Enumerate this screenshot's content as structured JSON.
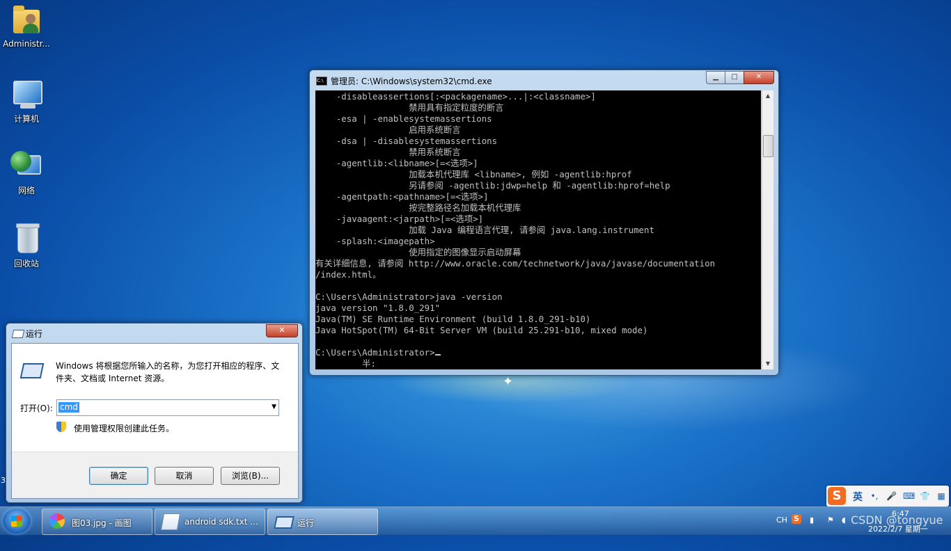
{
  "desktop": {
    "icons": [
      {
        "label": "Administr..."
      },
      {
        "label": "计算机"
      },
      {
        "label": "网络"
      },
      {
        "label": "回收站"
      }
    ]
  },
  "cmd_window": {
    "title": "管理员: C:\\Windows\\system32\\cmd.exe",
    "controls": {
      "minimize": "▁",
      "maximize": "□",
      "close": "✕"
    },
    "lines": [
      "    -disableassertions[:<packagename>...|:<classname>]",
      "                  禁用具有指定粒度的断言",
      "    -esa | -enablesystemassertions",
      "                  启用系统断言",
      "    -dsa | -disablesystemassertions",
      "                  禁用系统断言",
      "    -agentlib:<libname>[=<选项>]",
      "                  加载本机代理库 <libname>, 例如 -agentlib:hprof",
      "                  另请参阅 -agentlib:jdwp=help 和 -agentlib:hprof=help",
      "    -agentpath:<pathname>[=<选项>]",
      "                  按完整路径名加载本机代理库",
      "    -javaagent:<jarpath>[=<选项>]",
      "                  加载 Java 编程语言代理, 请参阅 java.lang.instrument",
      "    -splash:<imagepath>",
      "                  使用指定的图像显示启动屏幕",
      "有关详细信息, 请参阅 http://www.oracle.com/technetwork/java/javase/documentation",
      "/index.html。",
      "",
      "C:\\Users\\Administrator>java -version",
      "java version \"1.8.0_291\"",
      "Java(TM) SE Runtime Environment (build 1.8.0_291-b10)",
      "Java HotSpot(TM) 64-Bit Server VM (build 25.291-b10, mixed mode)",
      "",
      "C:\\Users\\Administrator>"
    ],
    "ime_hint": "         半:"
  },
  "run_dialog": {
    "title": "运行",
    "close": "✕",
    "description": "Windows 将根据您所输入的名称，为您打开相应的程序、文件夹、文档或 Internet 资源。",
    "open_label": "打开(O):",
    "input_value": "cmd",
    "admin_text": "使用管理权限创建此任务。",
    "ok": "确定",
    "cancel": "取消",
    "browse": "浏览(B)..."
  },
  "stray_text": "3",
  "taskbar": {
    "items": [
      {
        "label": "图03.jpg - 画图"
      },
      {
        "label": "android sdk.txt ..."
      },
      {
        "label": "运行"
      }
    ],
    "tray": {
      "lang": "CH",
      "time": "6:47",
      "date": "2022/2/7 星期一",
      "watermark": "CSDN @tongyue"
    }
  },
  "ime_bar": {
    "logo": "S",
    "mode": "英",
    "items": [
      "•,",
      "🎤",
      "⌨",
      "👕",
      "▦"
    ]
  }
}
